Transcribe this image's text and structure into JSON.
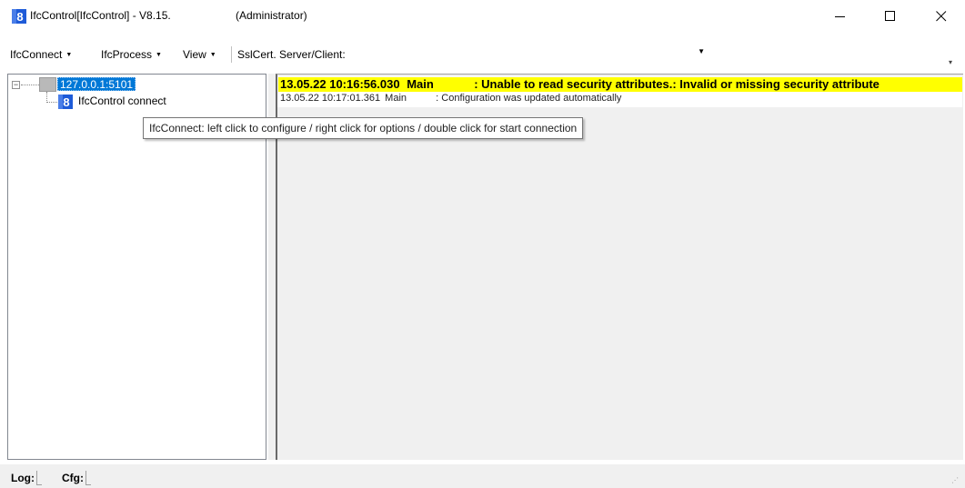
{
  "window": {
    "title": "IfcControl[IfcControl] - V8.15.",
    "admin_label": "(Administrator)",
    "app_icon": "ifc-8-icon",
    "controls": [
      "minimize-icon",
      "maximize-icon",
      "close-icon"
    ]
  },
  "toolbar": {
    "ifcconnect_label": "IfcConnect",
    "ifcprocess_label": "IfcProcess",
    "view_label": "View",
    "sslcert_label": "SslCert. Server/Client:",
    "sslcert_value": ""
  },
  "tree": {
    "root_label": "127.0.0.1:5101",
    "child_label": "IfcControl connect"
  },
  "tooltip": {
    "text": "IfcConnect: left click to configure / right click for options / double click for start connection"
  },
  "log": {
    "rows": [
      {
        "timestamp": "13.05.22 10:16:56.030",
        "source": "Main",
        "message": ": Unable to read security attributes.: Invalid or missing security attribute",
        "highlight": "#ffff00"
      },
      {
        "timestamp": "13.05.22 10:17:01.361",
        "source": "Main",
        "message": ": Configuration was updated automatically",
        "highlight": ""
      }
    ]
  },
  "statusbar": {
    "log_label": "Log:",
    "cfg_label": "Cfg:"
  },
  "colors": {
    "selection": "#0078d7",
    "warning_bg": "#ffff00"
  }
}
